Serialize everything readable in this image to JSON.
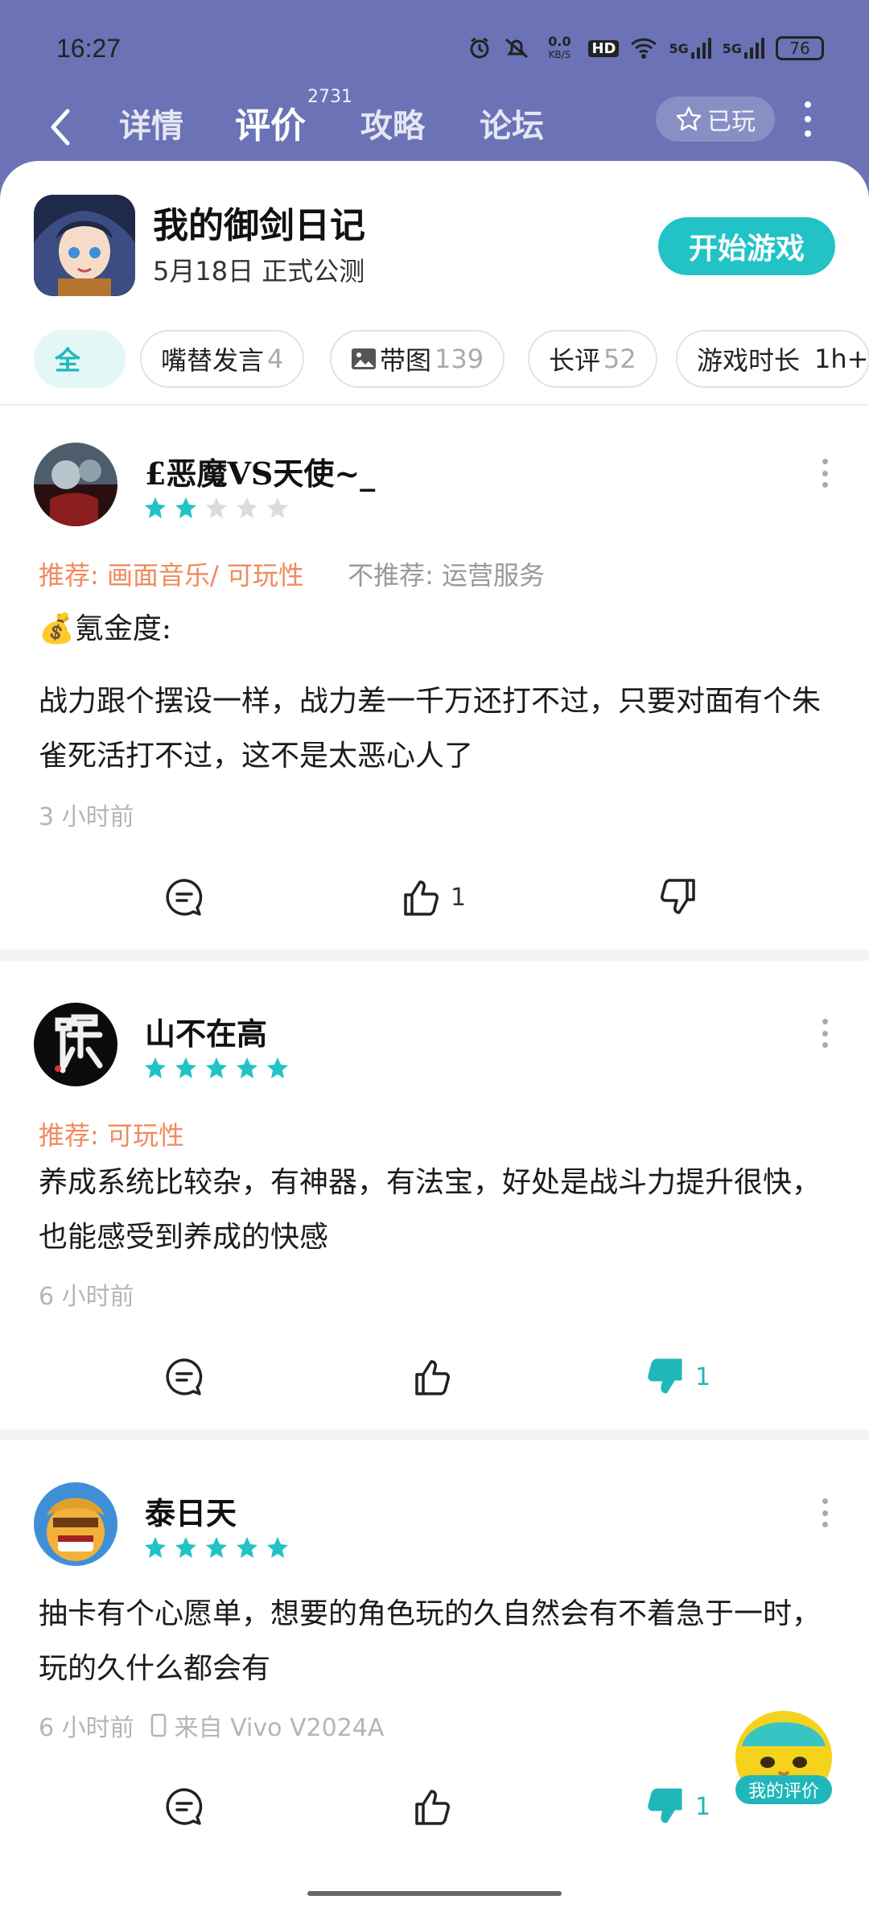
{
  "status_bar": {
    "time": "16:27",
    "net_speed": "0.0",
    "net_unit": "KB/S",
    "hd": "HD",
    "signal1": "5G",
    "signal2": "5G",
    "battery": "76"
  },
  "nav": {
    "tabs": [
      {
        "label": "详情"
      },
      {
        "label": "评价"
      },
      {
        "label": "攻略"
      },
      {
        "label": "论坛"
      }
    ],
    "review_count_badge": "2731",
    "played_label": "已玩"
  },
  "game": {
    "title": "我的御剑日记",
    "subtitle": "5月18日 正式公测",
    "play_button": "开始游戏"
  },
  "filters": [
    {
      "label": "全",
      "count": ""
    },
    {
      "label": "嘴替发言",
      "count": "4"
    },
    {
      "label": "带图",
      "count": "139"
    },
    {
      "label": "长评",
      "count": "52"
    },
    {
      "label": "游戏时长",
      "count": "1h+"
    }
  ],
  "reviews": [
    {
      "username": "£恶魔VS天使~_",
      "rating": 2,
      "recommend": "推荐: 画面音乐/ 可玩性",
      "not_recommend": "不推荐: 运营服务",
      "extra_line": "💰氪金度:",
      "text": "战力跟个摆设一样，战力差一千万还打不过，只要对面有个朱雀死活打不过，这不是太恶心人了",
      "time": "3 小时前",
      "likes": "1",
      "dislikes": ""
    },
    {
      "username": "山不在高",
      "rating": 5,
      "recommend": "推荐: 可玩性",
      "text": "养成系统比较杂，有神器，有法宝，好处是战斗力提升很快，也能感受到养成的快感",
      "time": "6 小时前",
      "likes": "",
      "dislikes": "1"
    },
    {
      "username": "泰日天",
      "rating": 5,
      "text": "抽卡有个心愿单，想要的角色玩的久自然会有不着急于一时，玩的久什么都会有",
      "time": "6 小时前",
      "device": "来自 Vivo V2024A",
      "likes": "",
      "dislikes": "1"
    }
  ],
  "fab": {
    "label": "我的评价"
  },
  "colors": {
    "header": "#6b73b6",
    "accent": "#21c3c6",
    "recommend": "#f08a5d"
  }
}
